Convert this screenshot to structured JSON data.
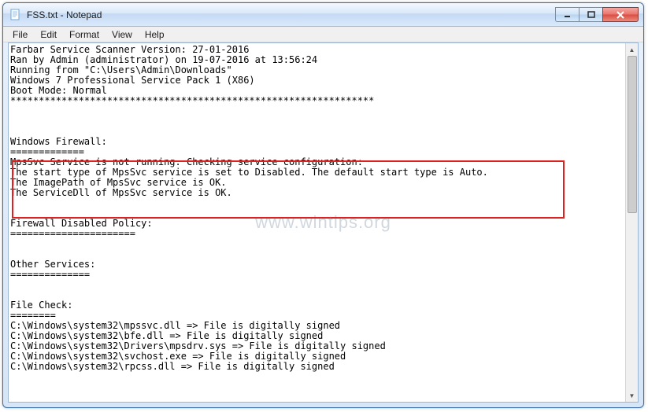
{
  "window": {
    "title": "FSS.txt - Notepad"
  },
  "menubar": {
    "items": [
      "File",
      "Edit",
      "Format",
      "View",
      "Help"
    ]
  },
  "content": {
    "lines": [
      "Farbar Service Scanner Version: 27-01-2016",
      "Ran by Admin (administrator) on 19-07-2016 at 13:56:24",
      "Running from \"C:\\Users\\Admin\\Downloads\"",
      "Windows 7 Professional Service Pack 1 (X86)",
      "Boot Mode: Normal",
      "****************************************************************",
      "",
      "",
      "",
      "Windows Firewall:",
      "=============",
      "MpsSvc Service is not running. Checking service configuration:",
      "The start type of MpsSvc service is set to Disabled. The default start type is Auto.",
      "The ImagePath of MpsSvc service is OK.",
      "The ServiceDll of MpsSvc service is OK.",
      "",
      "",
      "Firewall Disabled Policy:",
      "======================",
      "",
      "",
      "Other Services:",
      "==============",
      "",
      "",
      "File Check:",
      "========",
      "C:\\Windows\\system32\\mpssvc.dll => File is digitally signed",
      "C:\\Windows\\system32\\bfe.dll => File is digitally signed",
      "C:\\Windows\\system32\\Drivers\\mpsdrv.sys => File is digitally signed",
      "C:\\Windows\\system32\\svchost.exe => File is digitally signed",
      "C:\\Windows\\system32\\rpcss.dll => File is digitally signed"
    ]
  },
  "watermark": "www.wintips.org"
}
